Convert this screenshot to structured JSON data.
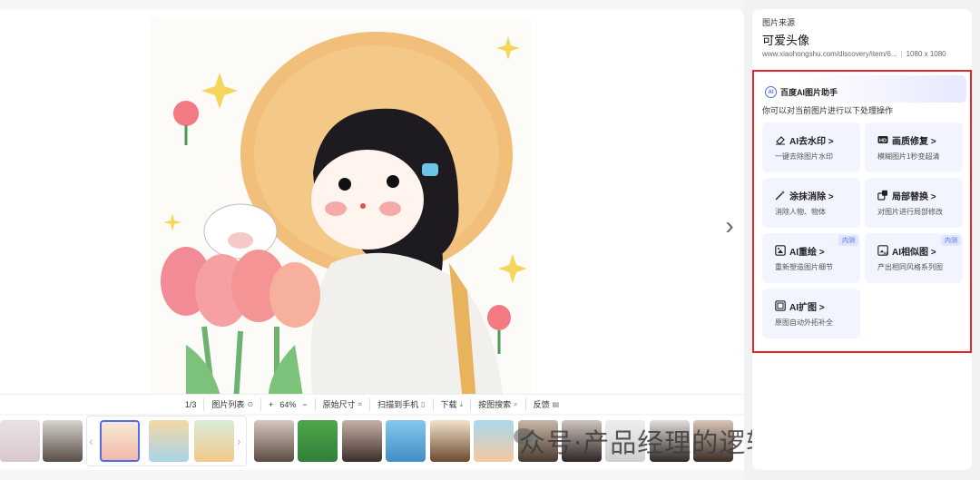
{
  "toolbar": {
    "page_counter": "1/3",
    "list_label": "图片列表",
    "zoom_in": "+",
    "zoom_value": "64%",
    "zoom_out": "−",
    "original_size": "原始尺寸",
    "scan_to_phone": "扫描到手机",
    "download": "下载",
    "search_by_image": "按图搜索",
    "feedback": "反馈"
  },
  "source": {
    "label": "图片来源",
    "title": "可爱头像",
    "url": "www.xiaohongshu.com/discovery/item/6...",
    "dimensions": "1080 x 1080"
  },
  "ai_helper": {
    "badge": "AI",
    "title": "百度AI图片助手",
    "subtitle": "你可以对当前图片进行以下处理操作",
    "tools": [
      {
        "name": "AI去水印",
        "desc": "一键去除图片水印",
        "icon": "eraser-icon",
        "beta": ""
      },
      {
        "name": "画质修复",
        "desc": "模糊图片1秒变超清",
        "icon": "hd-icon",
        "beta": ""
      },
      {
        "name": "涂抹消除",
        "desc": "消除人物、物体",
        "icon": "magic-wand-icon",
        "beta": ""
      },
      {
        "name": "局部替换",
        "desc": "对图片进行局部修改",
        "icon": "replace-icon",
        "beta": ""
      },
      {
        "name": "AI重绘",
        "desc": "重新塑造图片细节",
        "icon": "redraw-icon",
        "beta": "内测"
      },
      {
        "name": "AI相似图",
        "desc": "产出相同风格系列图",
        "icon": "similar-icon",
        "beta": "内测"
      },
      {
        "name": "AI扩图",
        "desc": "原图自动外拓补全",
        "icon": "expand-icon",
        "beta": ""
      }
    ],
    "arrow": ">"
  },
  "watermark": "众号·产品经理的逻辑与审美",
  "colors": {
    "accent": "#4e6ef2",
    "highlight_border": "#e5262b",
    "tool_bg": "#f2f5ff"
  }
}
